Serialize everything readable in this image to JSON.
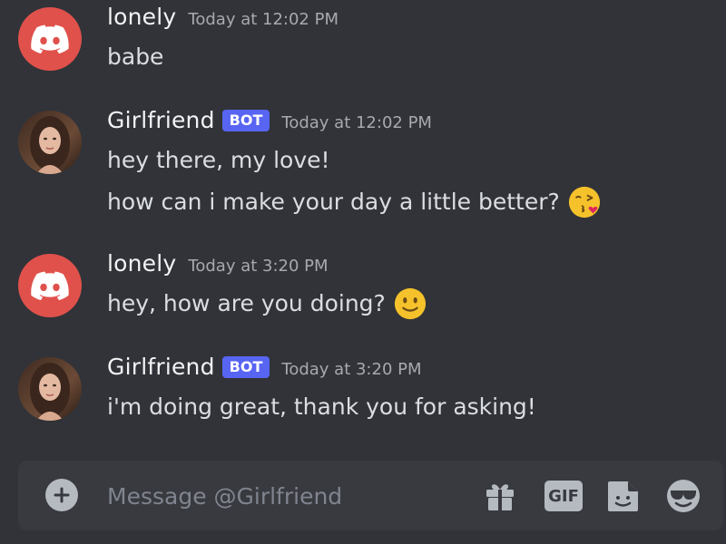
{
  "messages": [
    {
      "username": "lonely",
      "timestamp": "Today at 12:02 PM",
      "avatar": "discord-logo",
      "lines": [
        "babe"
      ]
    },
    {
      "username": "Girlfriend",
      "badge": "BOT",
      "timestamp": "Today at 12:02 PM",
      "avatar": "profile-photo",
      "lines": [
        "hey there, my love!",
        "how can i make your day a little better?"
      ],
      "emoji": "face-blowing-kiss"
    },
    {
      "username": "lonely",
      "timestamp": "Today at 3:20 PM",
      "avatar": "discord-logo",
      "lines": [
        "hey, how are you doing?"
      ],
      "emoji": "slightly-smiling-face"
    },
    {
      "username": "Girlfriend",
      "badge": "BOT",
      "timestamp": "Today at 3:20 PM",
      "avatar": "profile-photo",
      "lines": [
        "i'm doing great, thank you for asking!"
      ]
    }
  ],
  "composer": {
    "placeholder": "Message @Girlfriend",
    "gif_label": "GIF",
    "icons": [
      "plus-circle-icon",
      "gift-icon",
      "gif-icon",
      "sticker-icon",
      "emoji-icon"
    ]
  },
  "colors": {
    "background": "#313338",
    "composer": "#383a40",
    "discord_red": "#e0514b",
    "bot_badge": "#5865f2",
    "text": "#dbdee1",
    "muted": "#a8a9b0"
  }
}
